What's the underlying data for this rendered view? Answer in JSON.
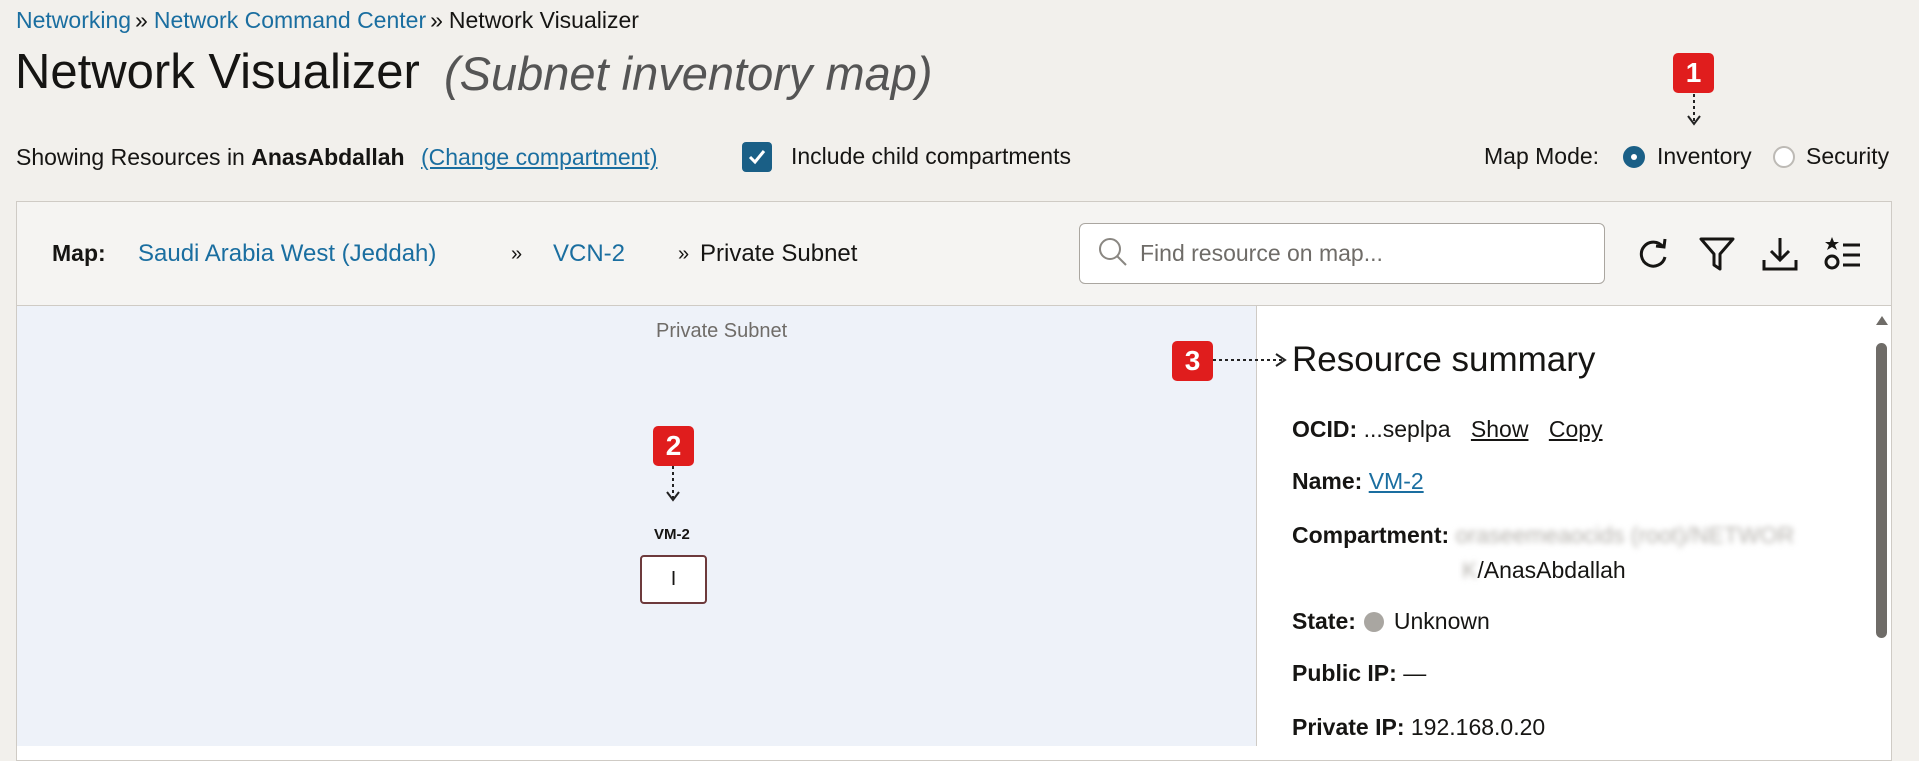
{
  "breadcrumb": [
    "Networking",
    "Network Command Center",
    "Network Visualizer"
  ],
  "breadcrumb_sep": "»",
  "page": {
    "title": "Network Visualizer",
    "subtitle": "(Subnet inventory map)"
  },
  "context": {
    "prefix": "Showing Resources in",
    "compartment": "AnasAbdallah",
    "change_link": "(Change compartment)",
    "include_child_label": "Include child compartments",
    "include_child_checked": true
  },
  "map_mode": {
    "label": "Map Mode:",
    "options": [
      "Inventory",
      "Security"
    ],
    "selected": "Inventory"
  },
  "toolbar": {
    "map_label": "Map:",
    "crumbs": [
      "Saudi Arabia West (Jeddah)",
      "VCN-2",
      "Private Subnet"
    ],
    "sep": "»",
    "search_placeholder": "Find resource on map..."
  },
  "canvas": {
    "label": "Private Subnet",
    "node": {
      "name": "VM-2",
      "glyph": "I"
    }
  },
  "callouts": [
    "1",
    "2",
    "3"
  ],
  "summary": {
    "title": "Resource summary",
    "ocid_label": "OCID:",
    "ocid_value": "...seplpa",
    "show_link": "Show",
    "copy_link": "Copy",
    "name_label": "Name:",
    "name_value": "VM-2",
    "compartment_label": "Compartment:",
    "compartment_hidden": "oraseemeaocids (root)/NETWOR",
    "compartment_hidden2": "K",
    "compartment_value": "/AnasAbdallah",
    "state_label": "State:",
    "state_value": "Unknown",
    "public_ip_label": "Public IP:",
    "public_ip_value": "—",
    "private_ip_label": "Private IP:",
    "private_ip_value": "192.168.0.20"
  },
  "colors": {
    "link": "#1a6ea0",
    "accent": "#1a5f86",
    "callout": "#e01d1d",
    "node_border": "#6d3a3c",
    "canvas_bg": "#eef2f9"
  },
  "icons": [
    "search-icon",
    "refresh-icon",
    "filter-icon",
    "download-icon",
    "legend-icon",
    "checkmark-icon"
  ]
}
